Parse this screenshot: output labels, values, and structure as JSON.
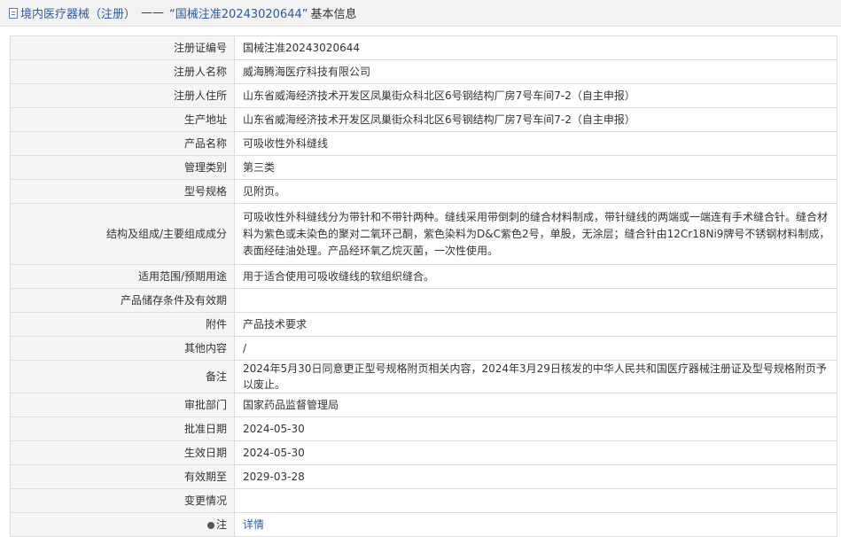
{
  "header": {
    "breadcrumb": "境内医疗器械（注册）",
    "separator": "——",
    "detail_title": "“国械注准20243020644”",
    "detail_suffix": "基本信息"
  },
  "rows": [
    {
      "label": "注册证编号",
      "value": "国械注准20243020644"
    },
    {
      "label": "注册人名称",
      "value": "威海腾海医疗科技有限公司"
    },
    {
      "label": "注册人住所",
      "value": "山东省威海经济技术开发区凤巢街众科北区6号钢结构厂房7号车间7-2（自主申报）"
    },
    {
      "label": "生产地址",
      "value": "山东省威海经济技术开发区凤巢街众科北区6号钢结构厂房7号车间7-2（自主申报）"
    },
    {
      "label": "产品名称",
      "value": "可吸收性外科缝线"
    },
    {
      "label": "管理类别",
      "value": "第三类"
    },
    {
      "label": "型号规格",
      "value": "见附页。"
    },
    {
      "label": "结构及组成/主要组成成分",
      "value": "可吸收性外科缝线分为带针和不带针两种。缝线采用带倒刺的缝合材料制成，带针缝线的两端或一端连有手术缝合针。缝合材料为紫色或未染色的聚对二氧环己酮，紫色染料为D&C紫色2号，单股，无涂层；缝合针由12Cr18Ni9牌号不锈钢材料制成，表面经硅油处理。产品经环氧乙烷灭菌，一次性使用。"
    },
    {
      "label": "适用范围/预期用途",
      "value": "用于适合使用可吸收缝线的软组织缝合。"
    },
    {
      "label": "产品储存条件及有效期",
      "value": ""
    },
    {
      "label": "附件",
      "value": "产品技术要求"
    },
    {
      "label": "其他内容",
      "value": "/"
    },
    {
      "label": "备注",
      "value": "2024年5月30日同意更正型号规格附页相关内容，2024年3月29日核发的中华人民共和国医疗器械注册证及型号规格附页予以废止。"
    },
    {
      "label": "审批部门",
      "value": "国家药品监督管理局"
    },
    {
      "label": "批准日期",
      "value": "2024-05-30"
    },
    {
      "label": "生效日期",
      "value": "2024-05-30"
    },
    {
      "label": "有效期至",
      "value": "2029-03-28"
    },
    {
      "label": "变更情况",
      "value": ""
    },
    {
      "label": "注",
      "value": "详情"
    }
  ]
}
